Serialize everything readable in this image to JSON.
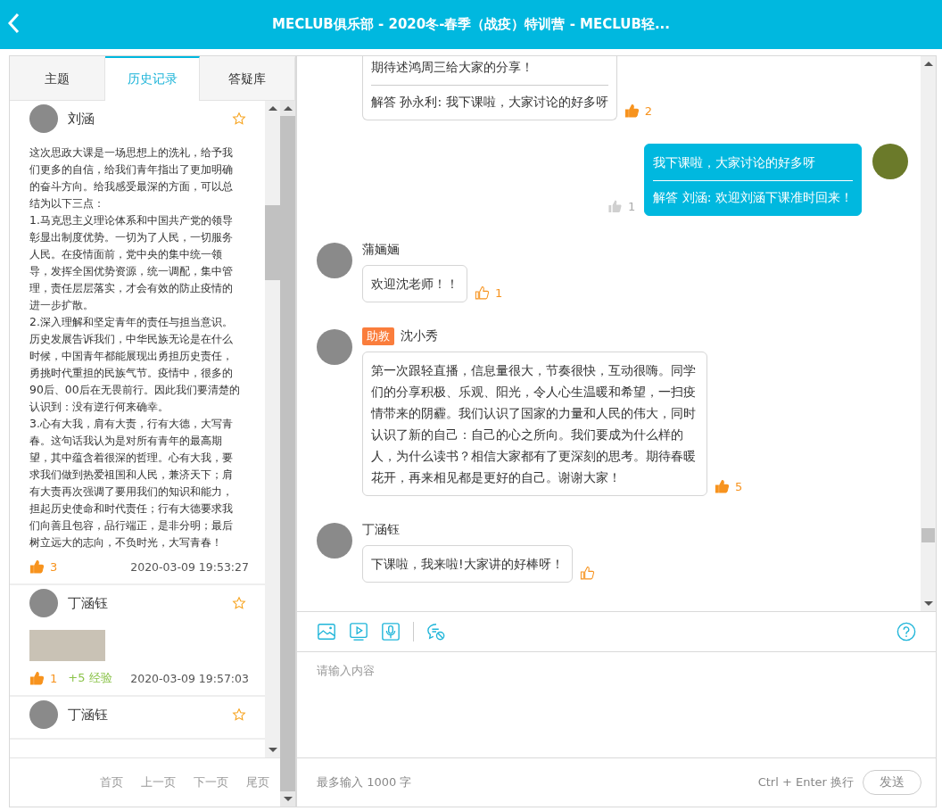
{
  "header": {
    "title": "MECLUB俱乐部 - 2020冬-春季（战疫）特训营 - MECLUB轻..."
  },
  "tabs": [
    {
      "label": "主题",
      "selected": false
    },
    {
      "label": "历史记录",
      "selected": true
    },
    {
      "label": "答疑库",
      "selected": false
    }
  ],
  "history": [
    {
      "name": "刘涵",
      "starred": false,
      "text": "这次思政大课是一场思想上的洗礼，给予我们更多的自信，给我们青年指出了更加明确的奋斗方向。给我感受最深的方面，可以总结为以下三点：\n1.马克思主义理论体系和中国共产党的领导彰显出制度优势。一切为了人民，一切服务人民。在疫情面前，党中央的集中统一领导，发挥全国优势资源，统一调配，集中管理，责任层层落实，才会有效的防止疫情的进一步扩散。\n2.深入理解和坚定青年的责任与担当意识。历史发展告诉我们，中华民族无论是在什么时候，中国青年都能展现出勇担历史责任，勇挑时代重担的民族气节。疫情中，很多的90后、00后在无畏前行。因此我们要清楚的认识到：没有逆行何来确幸。\n3.心有大我，肩有大责，行有大德，大写青春。这句话我认为是对所有青年的最高期望，其中蕴含着很深的哲理。心有大我，要求我们做到热爱祖国和人民，兼济天下；肩有大责再次强调了要用我们的知识和能力，担起历史使命和时代责任；行有大德要求我们向善且包容，品行端正，是非分明；最后树立远大的志向，不负时光，大写青春！",
      "liked": true,
      "likes": "3",
      "time": "2020-03-09 19:53:27"
    },
    {
      "name": "丁涵钰",
      "starred": false,
      "photo": true,
      "liked": true,
      "likes": "1",
      "exp": "+5 经验",
      "time": "2020-03-09 19:57:03"
    },
    {
      "name": "丁涵钰",
      "starred": false
    }
  ],
  "pager": [
    "首页",
    "上一页",
    "下一页",
    "尾页"
  ],
  "messages": [
    {
      "kind": "incoming",
      "text": "期待述鸿周三给大家的分享！",
      "reply": "解答 孙永利: 我下课啦，大家讨论的好多呀",
      "liked": true,
      "likes": "2"
    },
    {
      "kind": "own",
      "text": "我下课啦，大家讨论的好多呀",
      "reply": "解答 刘涵: 欢迎刘涵下课准时回来！",
      "likes": "1"
    },
    {
      "kind": "incoming",
      "name": "蒲婳婳",
      "text": "欢迎沈老师！！",
      "liked": false,
      "likes": "1"
    },
    {
      "kind": "incoming",
      "name": "沈小秀",
      "badge": "助教",
      "text": "第一次跟轻直播，信息量很大，节奏很快，互动很嗨。同学们的分享积极、乐观、阳光，令人心生温暖和希望，一扫疫情带来的阴霾。我们认识了国家的力量和人民的伟大，同时认识了新的自己：自己的心之所向。我们要成为什么样的人，为什么读书？相信大家都有了更深刻的思考。期待春暖花开，再来相见都是更好的自己。谢谢大家！",
      "liked": true,
      "likes": "5"
    },
    {
      "kind": "incoming",
      "name": "丁涵钰",
      "text": "下课啦，我来啦!大家讲的好棒呀！",
      "liked": false
    }
  ],
  "composer": {
    "placeholder": "请输入内容",
    "limit": "最多输入 1000 字",
    "hint": "Ctrl + Enter 换行",
    "send": "发送"
  }
}
